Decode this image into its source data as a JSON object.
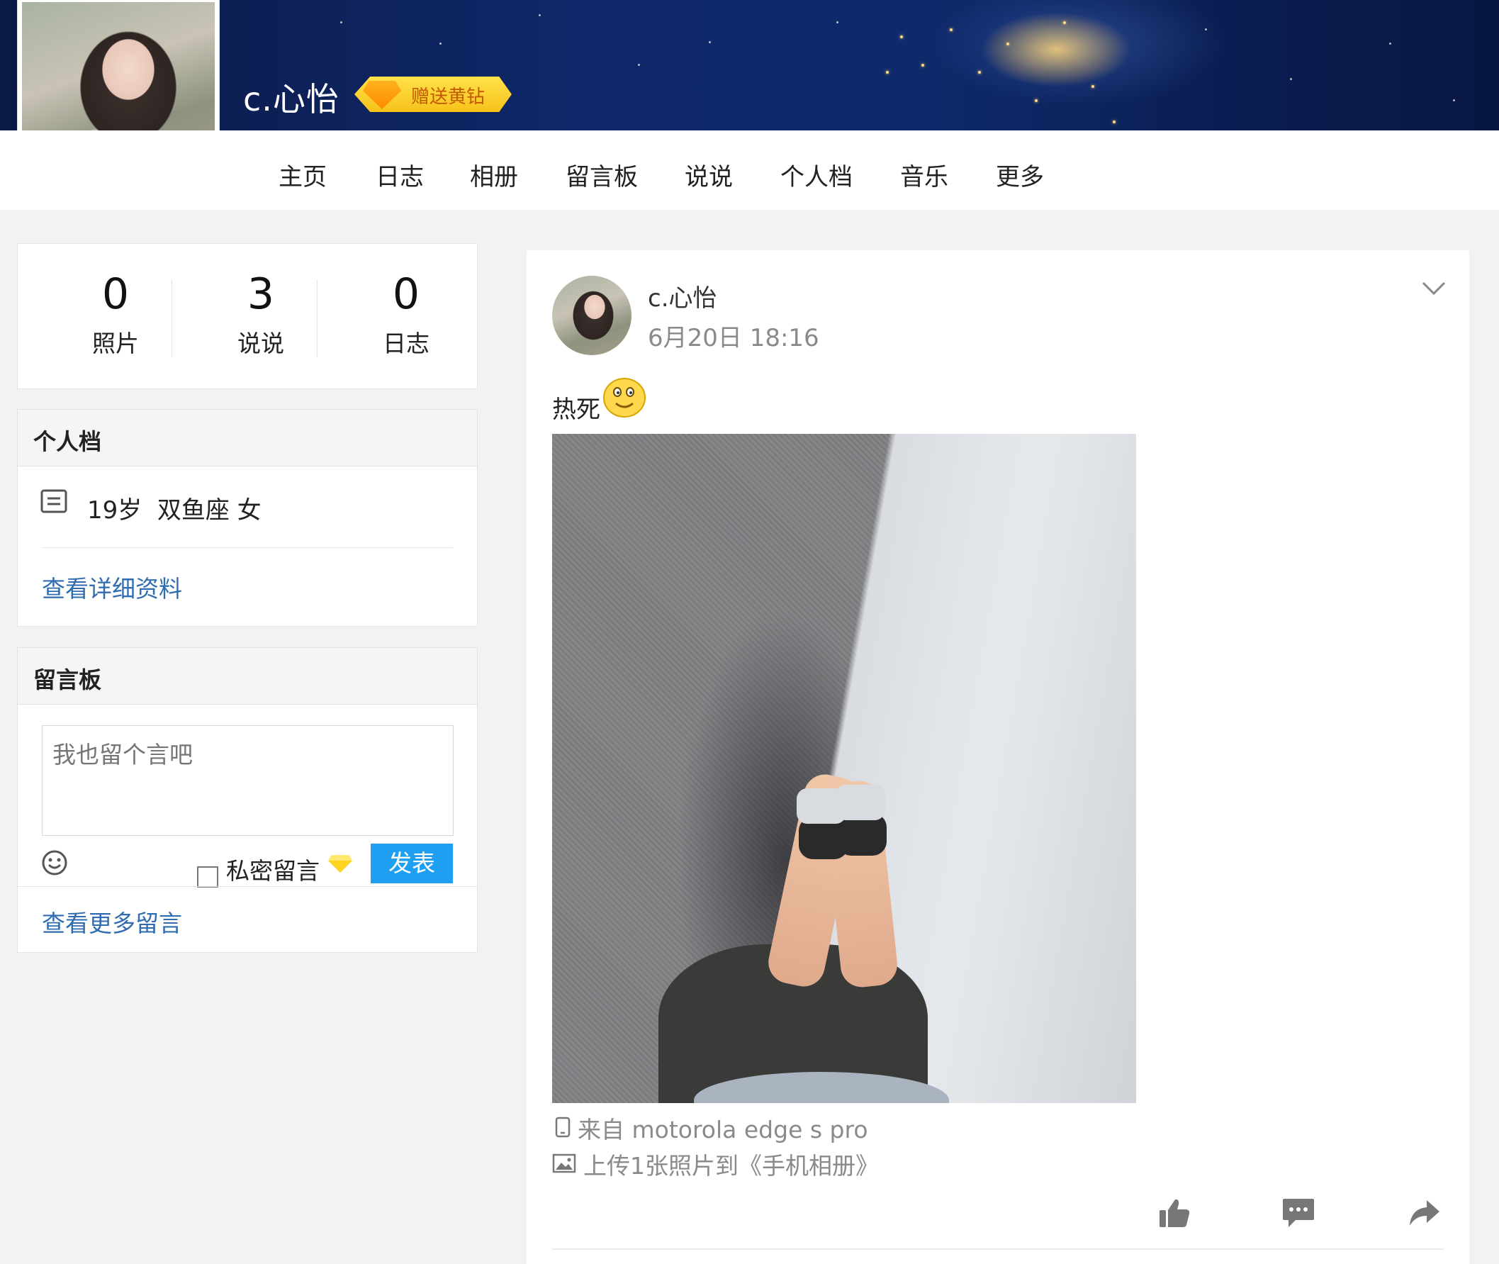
{
  "header": {
    "username": "c.心怡",
    "gift_badge": "赠送黄钻"
  },
  "nav": {
    "items": [
      "主页",
      "日志",
      "相册",
      "留言板",
      "说说",
      "个人档",
      "音乐",
      "更多"
    ]
  },
  "stats": [
    {
      "value": "0",
      "label": "照片"
    },
    {
      "value": "3",
      "label": "说说"
    },
    {
      "value": "0",
      "label": "日志"
    }
  ],
  "profile_card": {
    "title": "个人档",
    "info": "19岁  双鱼座 女",
    "detail_link": "查看详细资料"
  },
  "guestbook": {
    "title": "留言板",
    "placeholder": "我也留个言吧",
    "private_label": "私密留言",
    "submit_label": "发表",
    "more_link": "查看更多留言"
  },
  "post": {
    "author": "c.心怡",
    "time": "6月20日 18:16",
    "text": "热死",
    "device": "来自 motorola edge s pro",
    "upload_info": "上传1张照片到《手机相册》"
  },
  "colors": {
    "link": "#2f6cb0",
    "submit_button": "#1e9ff2",
    "gift_badge": "#f7c21a"
  }
}
